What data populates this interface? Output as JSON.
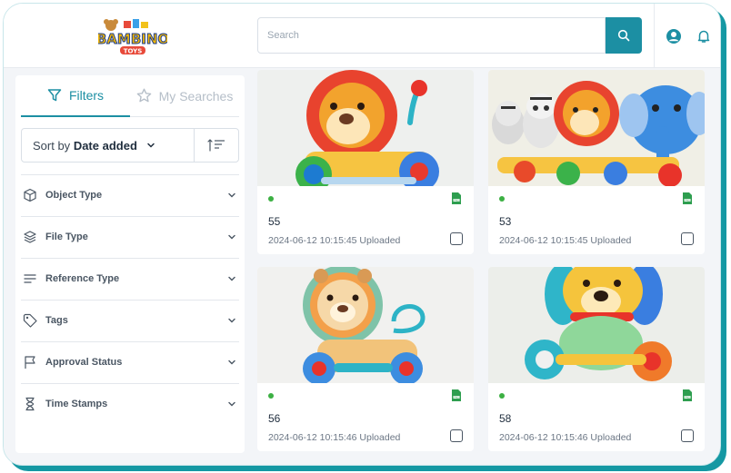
{
  "header": {
    "logo_text": "BAMBINO",
    "logo_subtext": "TOYS",
    "search_placeholder": "Search"
  },
  "sidebar": {
    "tabs": [
      {
        "label": "Filters",
        "active": true
      },
      {
        "label": "My Searches",
        "active": false
      }
    ],
    "sort": {
      "prefix": "Sort by",
      "value": "Date added"
    },
    "filters": [
      {
        "label": "Object Type",
        "icon": "cube-icon"
      },
      {
        "label": "File Type",
        "icon": "layers-icon"
      },
      {
        "label": "Reference Type",
        "icon": "lines-icon"
      },
      {
        "label": "Tags",
        "icon": "tag-icon"
      },
      {
        "label": "Approval Status",
        "icon": "flag-icon"
      },
      {
        "label": "Time Stamps",
        "icon": "hourglass-icon"
      }
    ]
  },
  "cards": [
    {
      "name": "55",
      "meta": "2024-06-12 10:15:45 Uploaded",
      "file_type": "PNG"
    },
    {
      "name": "53",
      "meta": "2024-06-12 10:15:45 Uploaded",
      "file_type": "PNG"
    },
    {
      "name": "56",
      "meta": "2024-06-12 10:15:46 Uploaded",
      "file_type": "PNG"
    },
    {
      "name": "58",
      "meta": "2024-06-12 10:15:46 Uploaded",
      "file_type": "PNG"
    }
  ],
  "colors": {
    "accent": "#1c8fa3",
    "status_ok": "#3cb043",
    "file_icon": "#2e9e4f"
  }
}
